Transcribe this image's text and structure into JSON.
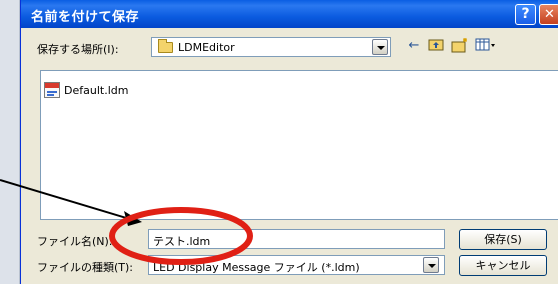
{
  "dialog": {
    "title": "名前を付けて保存",
    "help_button": "?",
    "close_button": "✕"
  },
  "location": {
    "label": "保存する場所(I):",
    "selected_folder": "LDMEditor"
  },
  "files": [
    {
      "name": "Default.ldm"
    }
  ],
  "filename": {
    "label": "ファイル名(N):",
    "value": "テスト.ldm"
  },
  "filetype": {
    "label": "ファイルの種類(T):",
    "value": "LED Display Message ファイル (*.ldm)"
  },
  "buttons": {
    "save": "保存(S)",
    "cancel": "キャンセル"
  },
  "toolbar_icons": [
    "back-arrow-icon",
    "up-folder-icon",
    "new-folder-icon",
    "view-menu-icon"
  ],
  "colors": {
    "title_bar": "#0a5ee3",
    "annotation_circle": "#e02015",
    "annotation_arrow": "#000000"
  }
}
